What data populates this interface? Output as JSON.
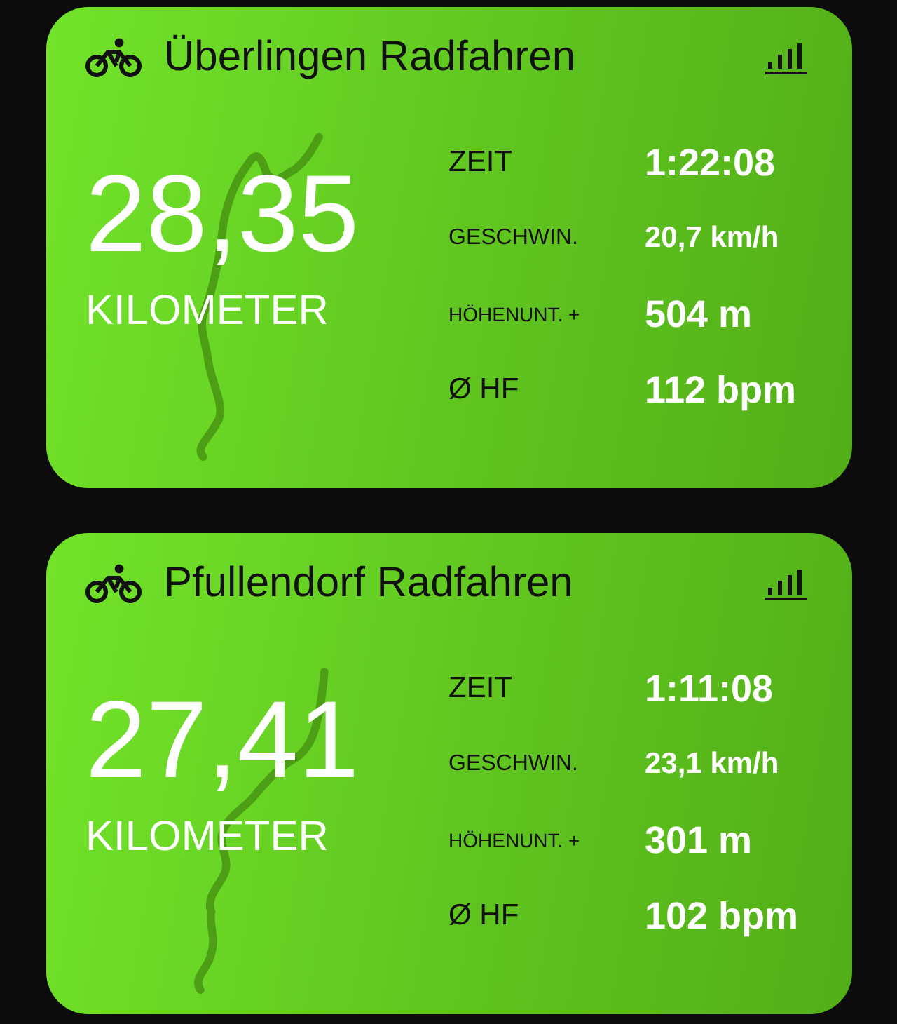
{
  "workouts": [
    {
      "title": "Überlingen Radfahren",
      "distance": "28,35",
      "unit": "KILOMETER",
      "stats": [
        {
          "label": "ZEIT",
          "value": "1:22:08",
          "kind": "large"
        },
        {
          "label": "GESCHWIN.",
          "value": "20,7 km/h",
          "kind": "small"
        },
        {
          "label": "HÖHENUNT. +",
          "value": "504 m",
          "kind": "large"
        },
        {
          "label": "Ø HF",
          "value": "112 bpm",
          "kind": "large"
        }
      ]
    },
    {
      "title": "Pfullendorf Radfahren",
      "distance": "27,41",
      "unit": "KILOMETER",
      "stats": [
        {
          "label": "ZEIT",
          "value": "1:11:08",
          "kind": "large"
        },
        {
          "label": "GESCHWIN.",
          "value": "23,1 km/h",
          "kind": "small"
        },
        {
          "label": "HÖHENUNT. +",
          "value": "301 m",
          "kind": "large"
        },
        {
          "label": "Ø HF",
          "value": "102 bpm",
          "kind": "large"
        }
      ]
    }
  ]
}
